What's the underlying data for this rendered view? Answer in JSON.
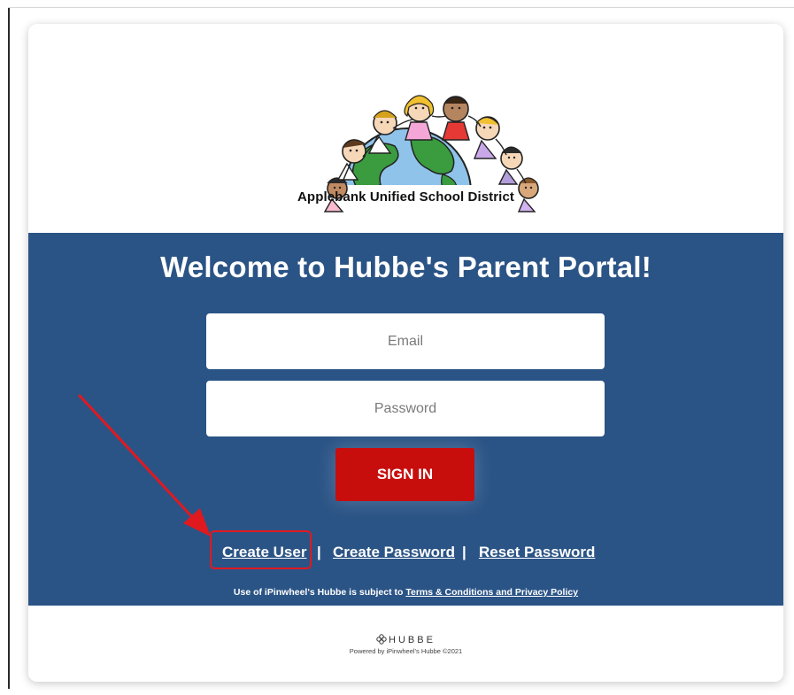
{
  "logo": {
    "icon": "children-around-globe-logo",
    "district_name": "Applebank Unified School District"
  },
  "login": {
    "welcome_title": "Welcome to Hubbe's Parent Portal!",
    "email_placeholder": "Email",
    "password_placeholder": "Password",
    "sign_in_label": "SIGN IN"
  },
  "links": {
    "create_user": "Create User",
    "separator": "|",
    "create_password": "Create Password",
    "reset_password": "Reset Password"
  },
  "terms": {
    "prefix": "Use of iPinwheel's Hubbe is subject to",
    "link": "Terms & Conditions and Privacy Policy"
  },
  "footer": {
    "brand": "HUBBE",
    "brand_icon": "hubbe-logo-icon",
    "powered_by": "Powered by iPinwheel's Hubbe ©2021"
  },
  "annotation": {
    "arrow_color": "#e0191f",
    "highlight_target": "Create User"
  },
  "colors": {
    "panel_blue": "#2b5486",
    "sign_in_red": "#c80d0d"
  }
}
